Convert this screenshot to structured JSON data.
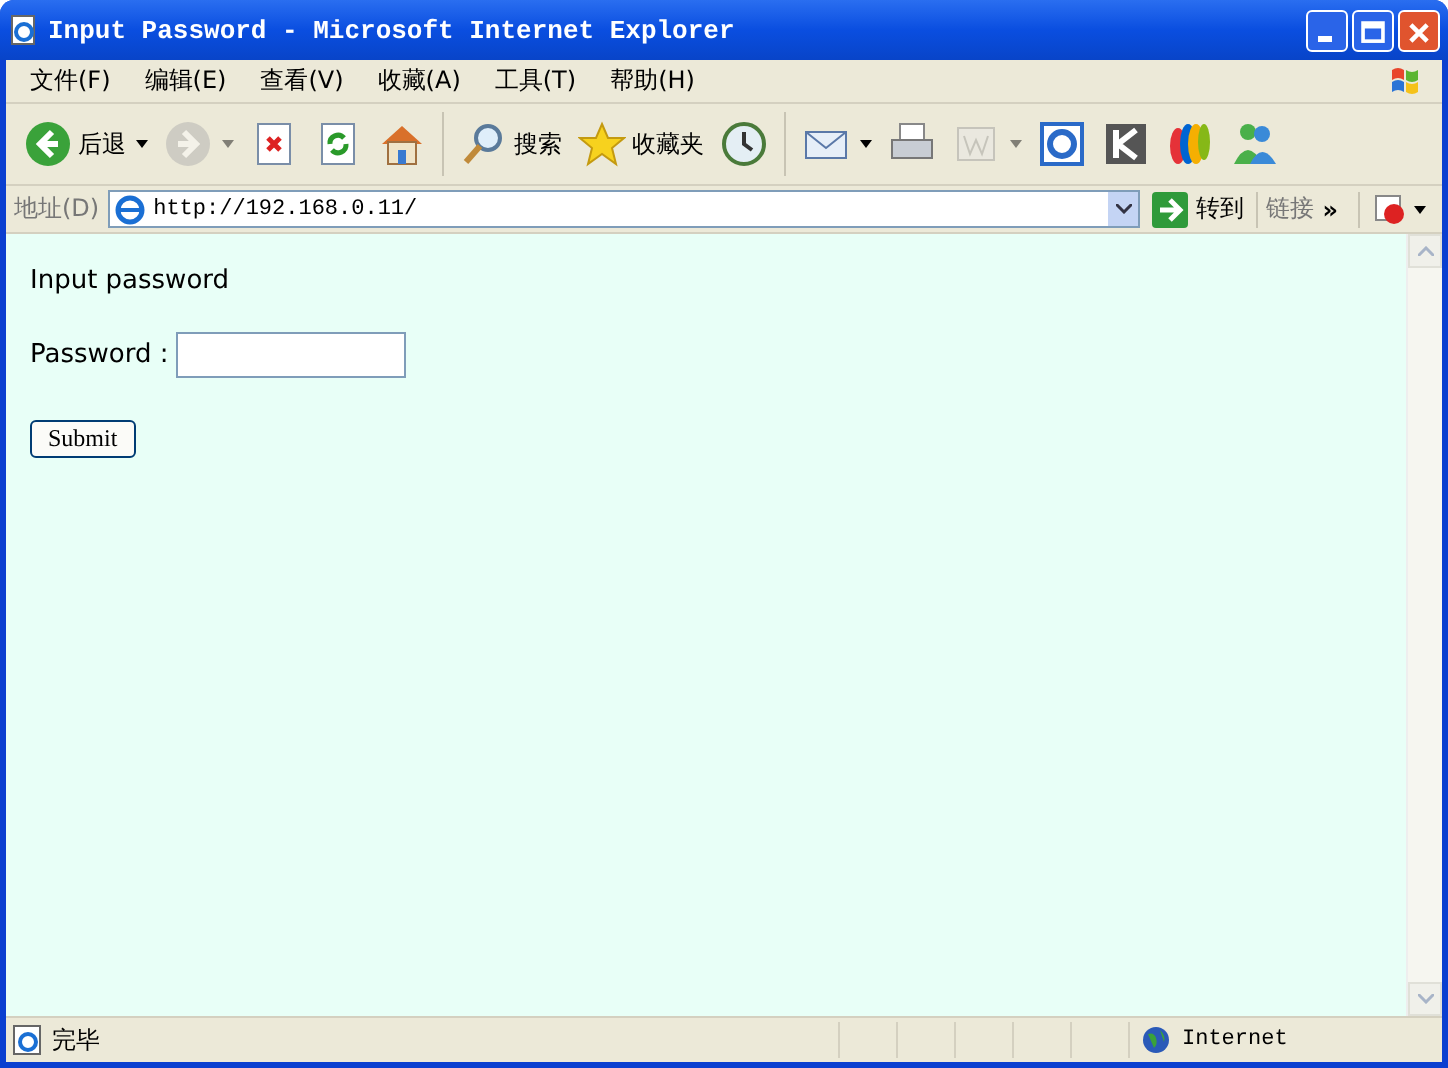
{
  "window": {
    "title": "Input Password - Microsoft Internet Explorer"
  },
  "menu": [
    "文件(F)",
    "编辑(E)",
    "查看(V)",
    "收藏(A)",
    "工具(T)",
    "帮助(H)"
  ],
  "toolbar": [
    {
      "kind": "back",
      "label": "后退",
      "dropdown": true,
      "disabled": false
    },
    {
      "kind": "forward",
      "dropdown": true,
      "disabled": true
    },
    {
      "kind": "stop",
      "disabled": false
    },
    {
      "kind": "refresh",
      "disabled": false
    },
    {
      "kind": "home",
      "disabled": false
    },
    {
      "kind": "search",
      "label": "搜索",
      "disabled": false
    },
    {
      "kind": "favorites",
      "label": "收藏夹",
      "disabled": false
    },
    {
      "kind": "history",
      "disabled": false
    },
    {
      "kind": "mail",
      "dropdown": true,
      "disabled": false
    },
    {
      "kind": "print",
      "disabled": false
    },
    {
      "kind": "edit",
      "dropdown": true,
      "disabled": true
    },
    {
      "kind": "ext-e",
      "disabled": false
    },
    {
      "kind": "ext-k",
      "disabled": false
    },
    {
      "kind": "ext-ebay",
      "disabled": false
    },
    {
      "kind": "messenger",
      "disabled": false
    }
  ],
  "address_bar": {
    "label": "地址(D)",
    "url": "http://192.168.0.11/",
    "go": "转到",
    "links": "链接",
    "more": "»"
  },
  "page": {
    "heading": "Input password",
    "field_label": "Password :",
    "submit": "Submit"
  },
  "status_bar": {
    "text": "完毕",
    "zone": "Internet"
  }
}
